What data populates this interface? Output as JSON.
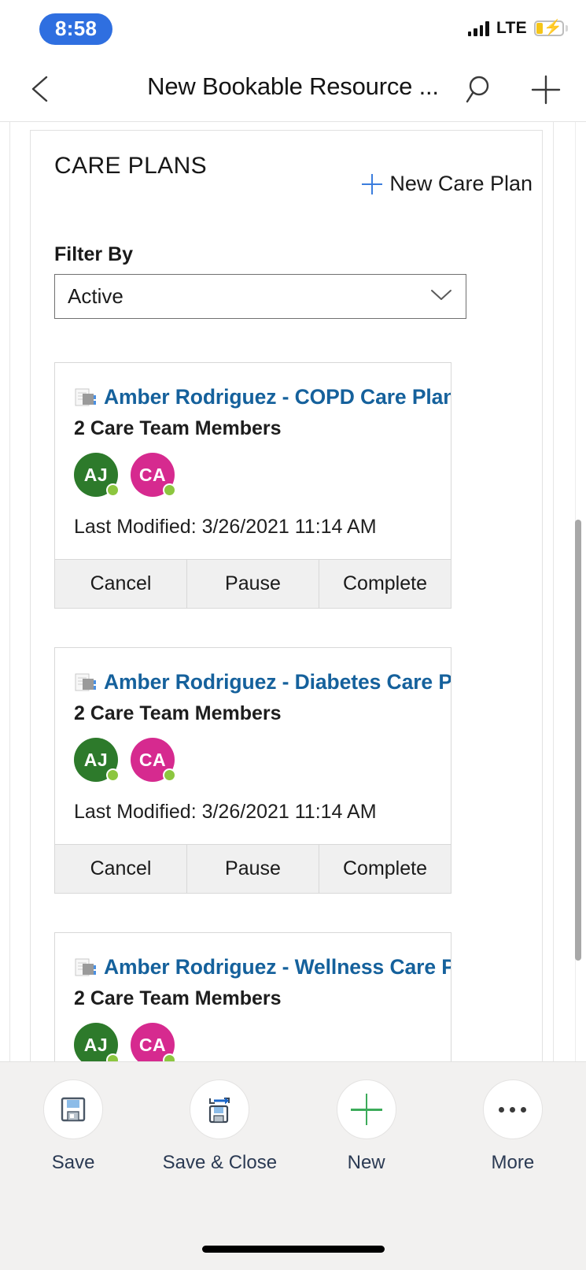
{
  "status_bar": {
    "time": "8:58",
    "network_label": "LTE",
    "signal_icon": "signal-bars-icon",
    "battery_icon": "battery-charging-icon",
    "recording_pill_color": "#2f6fe0",
    "battery_fill_color": "#f5c518"
  },
  "nav_bar": {
    "back_icon": "chevron-left-icon",
    "title": "New Bookable Resource ...",
    "search_icon": "search-icon",
    "add_icon": "plus-icon"
  },
  "panel": {
    "title": "CARE PLANS",
    "new_plan": {
      "icon": "plus-icon",
      "label": "New Care Plan",
      "accent_color": "#3b7ddd"
    },
    "filter": {
      "label": "Filter By",
      "value": "Active",
      "chevron_icon": "chevron-down-icon",
      "options": [
        "Active"
      ]
    }
  },
  "care_plans": [
    {
      "icon": "document-icon",
      "title": "Amber Rodriguez - COPD Care Plan",
      "members_text": "2 Care Team Members",
      "avatars": [
        {
          "initials": "AJ",
          "color": "#2d7a2b",
          "presence": "available"
        },
        {
          "initials": "CA",
          "color": "#d62a8f",
          "presence": "available"
        }
      ],
      "last_modified": "Last Modified: 3/26/2021 11:14 AM",
      "actions": [
        "Cancel",
        "Pause",
        "Complete"
      ]
    },
    {
      "icon": "document-icon",
      "title": "Amber Rodriguez - Diabetes Care Pla",
      "members_text": "2 Care Team Members",
      "avatars": [
        {
          "initials": "AJ",
          "color": "#2d7a2b",
          "presence": "available"
        },
        {
          "initials": "CA",
          "color": "#d62a8f",
          "presence": "available"
        }
      ],
      "last_modified": "Last Modified: 3/26/2021 11:14 AM",
      "actions": [
        "Cancel",
        "Pause",
        "Complete"
      ]
    },
    {
      "icon": "document-icon",
      "title": "Amber Rodriguez - Wellness Care Pla",
      "members_text": "2 Care Team Members",
      "avatars": [
        {
          "initials": "AJ",
          "color": "#2d7a2b",
          "presence": "available"
        },
        {
          "initials": "CA",
          "color": "#d62a8f",
          "presence": "available"
        }
      ],
      "last_modified": "",
      "actions": []
    }
  ],
  "command_bar": [
    {
      "icon": "save-icon",
      "label": "Save"
    },
    {
      "icon": "save-and-close-icon",
      "label": "Save & Close"
    },
    {
      "icon": "plus-icon",
      "label": "New"
    },
    {
      "icon": "more-ellipsis-icon",
      "label": "More"
    }
  ],
  "colors": {
    "link": "#15619c",
    "accent_blue": "#3b7ddd",
    "presence_green": "#8cc63f",
    "new_green": "#3cab5a",
    "command_bar_bg": "#f2f1f0"
  }
}
